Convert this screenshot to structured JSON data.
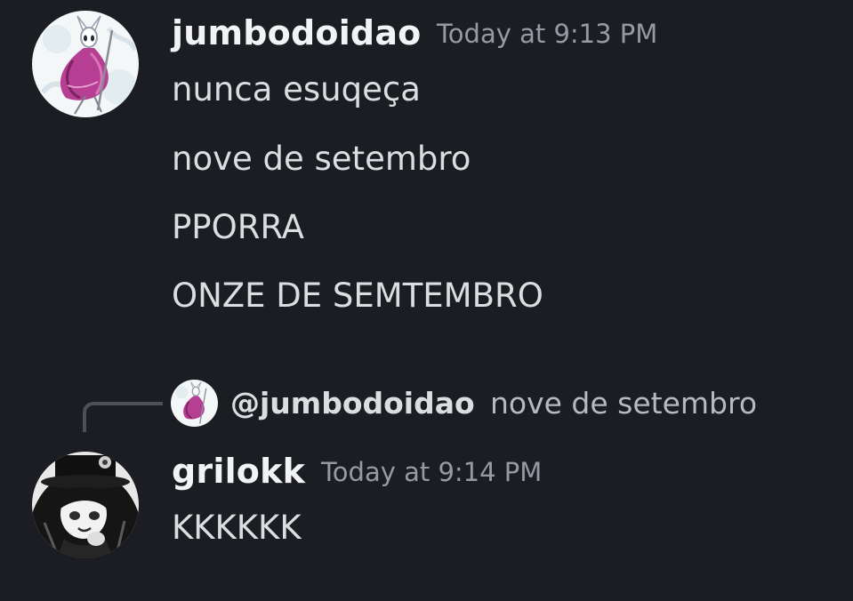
{
  "colors": {
    "background": "#1c1d22",
    "username": "#f2f3f5",
    "message_text": "#dbdee1",
    "timestamp": "#949ba4",
    "reply_line": "#4e5058"
  },
  "messages": [
    {
      "author": "jumbodoidao",
      "timestamp": "Today at 9:13 PM",
      "avatar_icon": "hollow-knight-hornet-avatar",
      "lines": [
        "nunca esuqeça",
        "nove de setembro",
        "PPORRA",
        "ONZE DE SEMTEMBRO"
      ]
    },
    {
      "author": "grilokk",
      "timestamp": "Today at 9:14 PM",
      "avatar_icon": "anime-character-avatar",
      "reply": {
        "mention": "@jumbodoidao",
        "text": "nove de setembro",
        "avatar_icon": "hollow-knight-hornet-avatar"
      },
      "lines": [
        "KKKKKK"
      ]
    }
  ]
}
